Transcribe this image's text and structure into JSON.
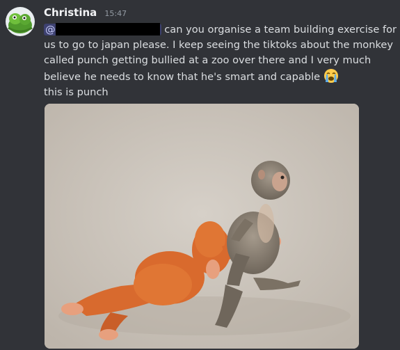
{
  "message": {
    "author": "Christina",
    "timestamp": "15:47",
    "mention_symbol": "@",
    "text_after_mention": "can you organise a team building exercise for us to go to japan please. I keep seeing the tiktoks about the monkey called punch getting bullied at a zoo over there and I very much believe he needs to know that he's smart and capable",
    "emoji": "loudly-crying-face-emoji",
    "second_line": "this is punch"
  },
  "attachment": {
    "type": "image",
    "subject": "baby macaque dragging an orange plush orangutan toy"
  },
  "colors": {
    "background": "#313338",
    "username": "#f2f3f5",
    "text": "#dbdee1",
    "timestamp": "#949ba4",
    "mention_bg": "#5865f2"
  }
}
